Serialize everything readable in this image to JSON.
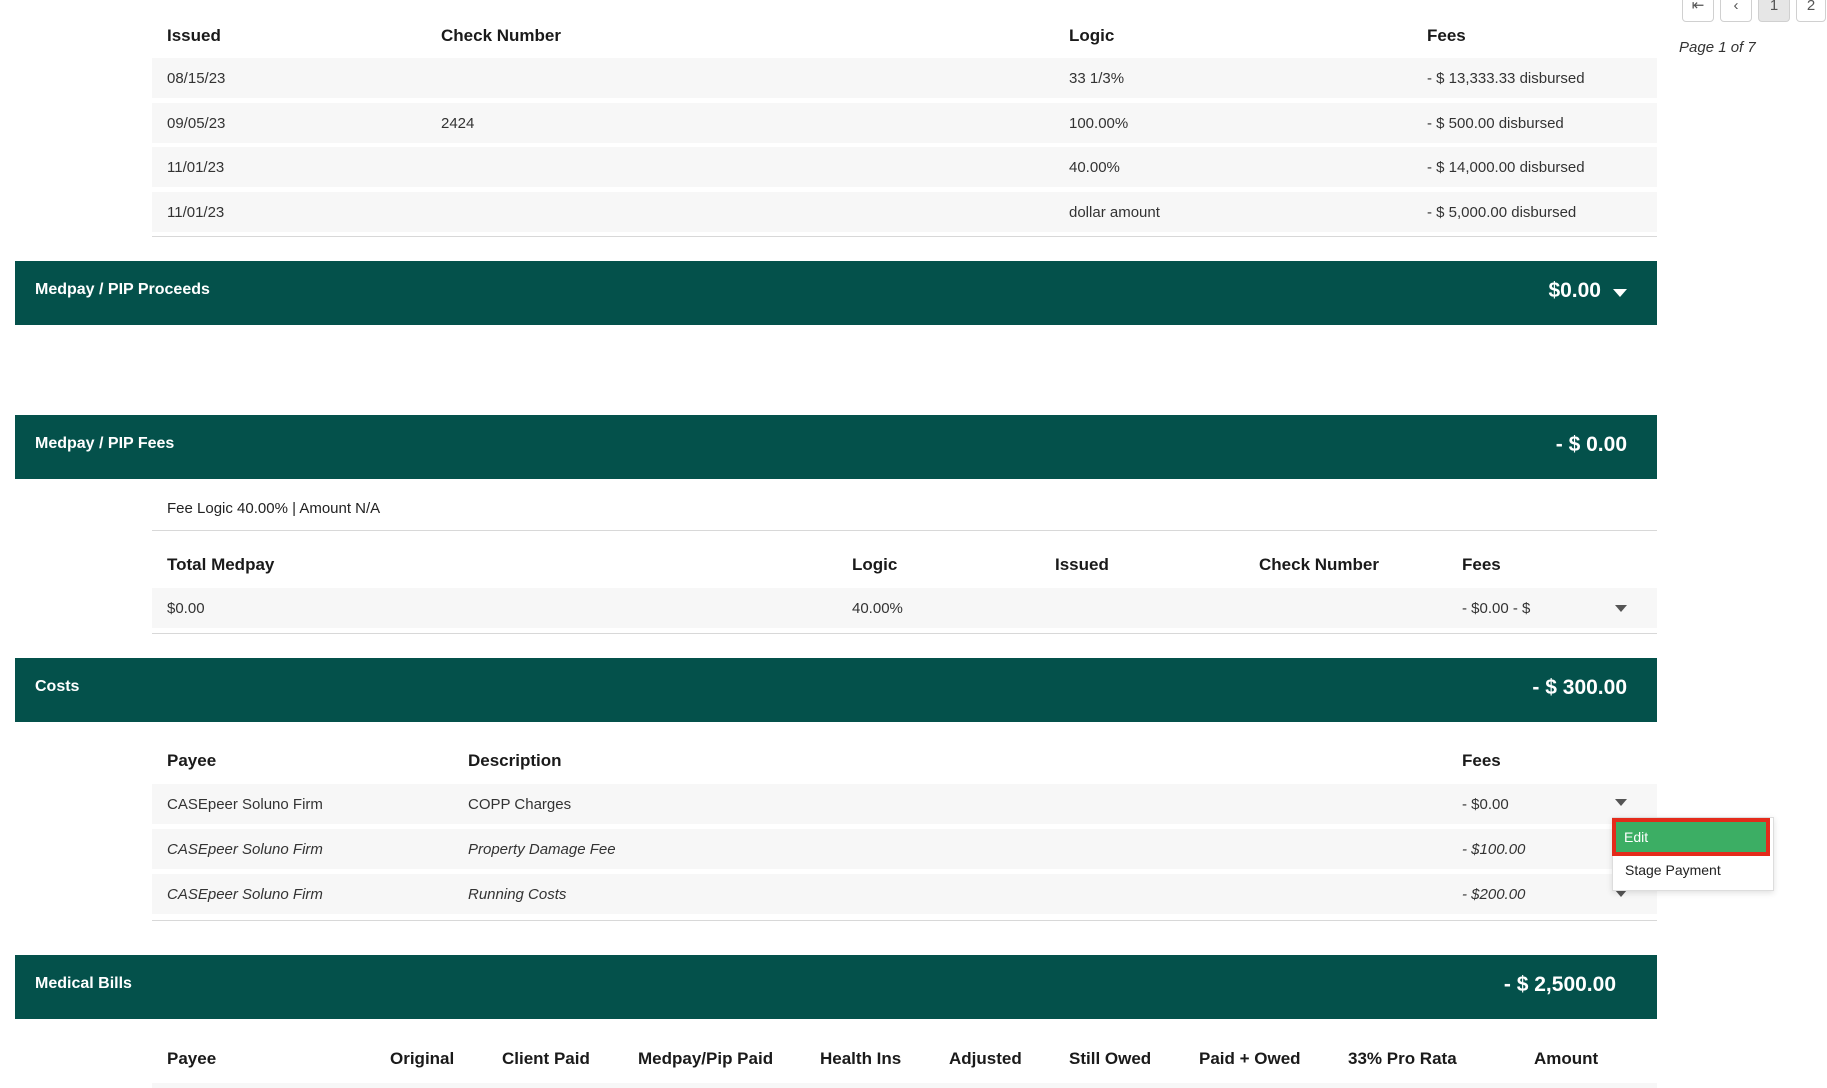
{
  "pagination": {
    "first": "⇤",
    "prev": "‹",
    "pages": [
      "1",
      "2"
    ],
    "page_text": "Page 1 of 7"
  },
  "disbursements": {
    "headers": {
      "issued": "Issued",
      "check": "Check Number",
      "logic": "Logic",
      "fees": "Fees"
    },
    "rows": [
      {
        "issued": "08/15/23",
        "check": "",
        "logic": "33 1/3%",
        "fees": "- $ 13,333.33 disbursed"
      },
      {
        "issued": "09/05/23",
        "check": "2424",
        "logic": "100.00%",
        "fees": "- $ 500.00 disbursed"
      },
      {
        "issued": "11/01/23",
        "check": "",
        "logic": "40.00%",
        "fees": "- $ 14,000.00 disbursed"
      },
      {
        "issued": "11/01/23",
        "check": "",
        "logic": "dollar amount",
        "fees": "- $ 5,000.00 disbursed"
      }
    ]
  },
  "medpay_proceeds": {
    "title": "Medpay / PIP Proceeds",
    "amount": "$0.00"
  },
  "medpay_fees": {
    "title": "Medpay / PIP Fees",
    "amount": "- $ 0.00",
    "fee_logic": "Fee Logic 40.00% | Amount N/A",
    "headers": {
      "total": "Total Medpay",
      "logic": "Logic",
      "issued": "Issued",
      "check": "Check Number",
      "fees": "Fees"
    },
    "row": {
      "total": "$0.00",
      "logic": "40.00%",
      "issued": "",
      "check": "",
      "fees": "- $0.00 - $"
    }
  },
  "costs": {
    "title": "Costs",
    "amount": "- $ 300.00",
    "headers": {
      "payee": "Payee",
      "description": "Description",
      "fees": "Fees"
    },
    "rows": [
      {
        "payee": "CASEpeer Soluno Firm",
        "description": "COPP Charges",
        "fees": "- $0.00"
      },
      {
        "payee": "CASEpeer Soluno Firm",
        "description": "Property Damage Fee",
        "fees": "- $100.00"
      },
      {
        "payee": "CASEpeer Soluno Firm",
        "description": "Running Costs",
        "fees": "- $200.00"
      }
    ]
  },
  "context_menu": {
    "edit": "Edit",
    "stage": "Stage Payment"
  },
  "medical_bills": {
    "title": "Medical Bills",
    "amount": "- $ 2,500.00",
    "headers": [
      "Payee",
      "Original",
      "Client Paid",
      "Medpay/Pip Paid",
      "Health Ins",
      "Adjusted",
      "Still Owed",
      "Paid + Owed",
      "33% Pro Rata",
      "Amount"
    ]
  },
  "colors": {
    "band": "#04514b",
    "menu_active": "#3cae64",
    "highlight": "#e42b1b"
  }
}
